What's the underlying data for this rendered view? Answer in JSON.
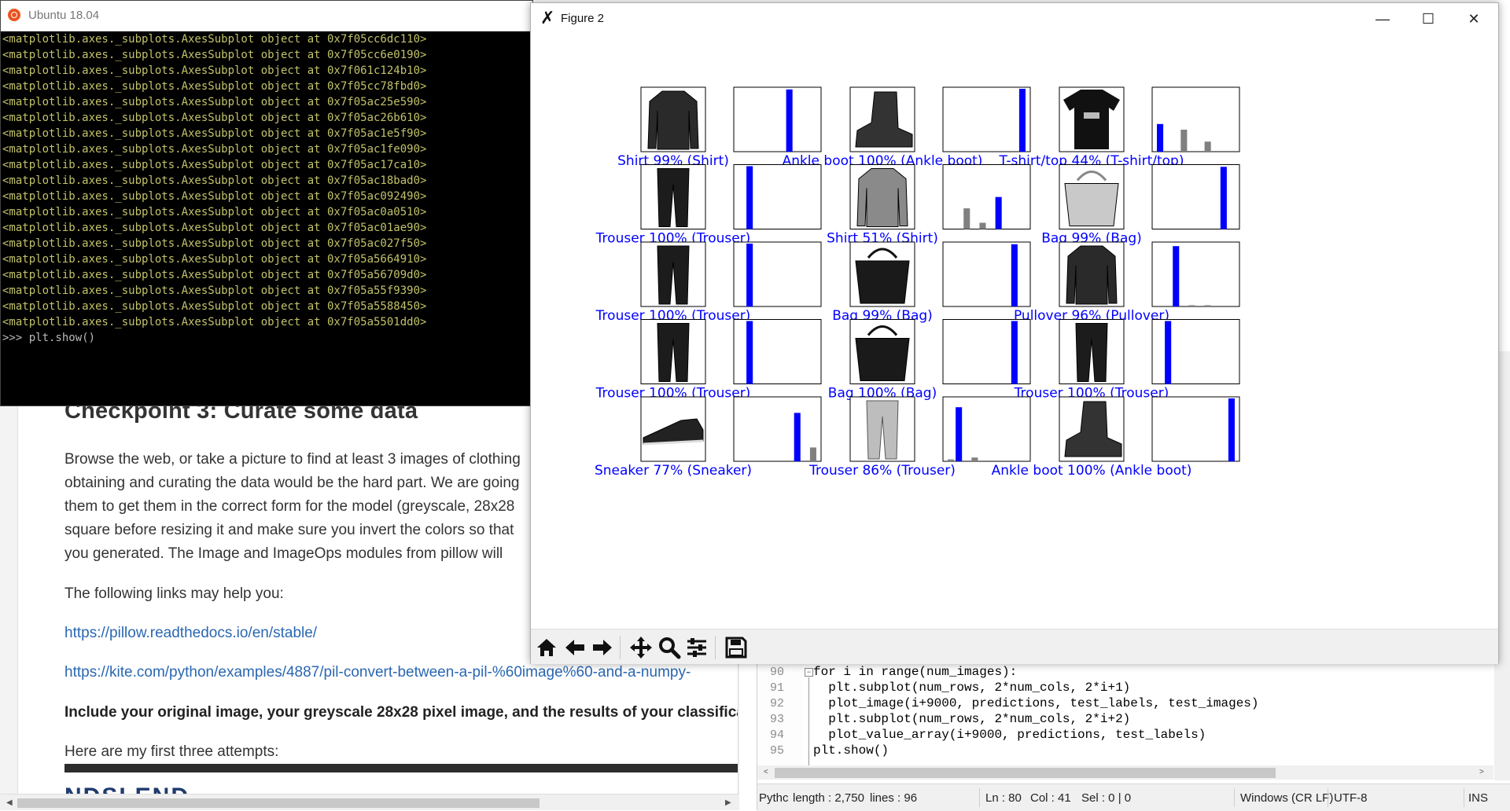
{
  "terminal": {
    "title": "Ubuntu 18.04",
    "lines": [
      "<matplotlib.axes._subplots.AxesSubplot object at 0x7f05cc6dc110>",
      "<matplotlib.axes._subplots.AxesSubplot object at 0x7f05cc6e0190>",
      "<matplotlib.axes._subplots.AxesSubplot object at 0x7f061c124b10>",
      "<matplotlib.axes._subplots.AxesSubplot object at 0x7f05cc78fbd0>",
      "<matplotlib.axes._subplots.AxesSubplot object at 0x7f05ac25e590>",
      "<matplotlib.axes._subplots.AxesSubplot object at 0x7f05ac26b610>",
      "<matplotlib.axes._subplots.AxesSubplot object at 0x7f05ac1e5f90>",
      "<matplotlib.axes._subplots.AxesSubplot object at 0x7f05ac1fe090>",
      "<matplotlib.axes._subplots.AxesSubplot object at 0x7f05ac17ca10>",
      "<matplotlib.axes._subplots.AxesSubplot object at 0x7f05ac18bad0>",
      "<matplotlib.axes._subplots.AxesSubplot object at 0x7f05ac092490>",
      "<matplotlib.axes._subplots.AxesSubplot object at 0x7f05ac0a0510>",
      "<matplotlib.axes._subplots.AxesSubplot object at 0x7f05ac01ae90>",
      "<matplotlib.axes._subplots.AxesSubplot object at 0x7f05ac027f50>",
      "<matplotlib.axes._subplots.AxesSubplot object at 0x7f05a5664910>",
      "<matplotlib.axes._subplots.AxesSubplot object at 0x7f05a56709d0>",
      "<matplotlib.axes._subplots.AxesSubplot object at 0x7f05a55f9390>",
      "<matplotlib.axes._subplots.AxesSubplot object at 0x7f05a5588450>",
      "<matplotlib.axes._subplots.AxesSubplot object at 0x7f05a5501dd0>"
    ],
    "prompt": ">>> plt.show()"
  },
  "figure": {
    "title": "Figure 2",
    "label_color": "#0000ff",
    "bar_color": "#0000ff",
    "other_bar_color": "#808080",
    "toolbar_icons": [
      "home-icon",
      "back-arrow-icon",
      "forward-arrow-icon",
      "pan-icon",
      "zoom-icon",
      "configure-subplots-icon",
      "save-icon"
    ]
  },
  "chart_data": {
    "type": "bar",
    "rows": 5,
    "cols": 3,
    "num_classes": 10,
    "ylim": [
      0,
      1
    ],
    "panels": [
      {
        "label": "Shirt 99% (Shirt)",
        "image": "shirt",
        "values": [
          0,
          0,
          0,
          0,
          0,
          0,
          0.99,
          0,
          0,
          0
        ]
      },
      {
        "label": "Ankle boot 100% (Ankle boot)",
        "image": "ankle boot",
        "values": [
          0,
          0,
          0,
          0,
          0,
          0,
          0,
          0,
          0,
          1.0
        ]
      },
      {
        "label": "T-shirt/top 44% (T-shirt/top)",
        "image": "t-shirt",
        "values": [
          0.44,
          0,
          0,
          0.35,
          0,
          0,
          0.16,
          0,
          0,
          0
        ]
      },
      {
        "label": "Trouser 100% (Trouser)",
        "image": "trouser",
        "values": [
          0,
          1.0,
          0,
          0,
          0,
          0,
          0,
          0,
          0,
          0
        ]
      },
      {
        "label": "Shirt 51% (Shirt)",
        "image": "shirt",
        "values": [
          0,
          0,
          0.33,
          0,
          0.1,
          0,
          0.51,
          0,
          0,
          0
        ]
      },
      {
        "label": "Bag 99% (Bag)",
        "image": "bag",
        "values": [
          0,
          0,
          0,
          0,
          0,
          0,
          0,
          0,
          0.99,
          0
        ]
      },
      {
        "label": "Trouser 100% (Trouser)",
        "image": "trouser",
        "values": [
          0,
          1.0,
          0,
          0,
          0,
          0,
          0,
          0,
          0,
          0
        ]
      },
      {
        "label": "Bag 99% (Bag)",
        "image": "bag",
        "values": [
          0,
          0,
          0,
          0,
          0,
          0,
          0,
          0,
          0.99,
          0
        ]
      },
      {
        "label": "Pullover 96% (Pullover)",
        "image": "pullover",
        "values": [
          0,
          0,
          0.96,
          0,
          0.02,
          0,
          0.02,
          0,
          0,
          0
        ]
      },
      {
        "label": "Trouser 100% (Trouser)",
        "image": "trouser",
        "values": [
          0,
          1.0,
          0,
          0,
          0,
          0,
          0,
          0,
          0,
          0
        ]
      },
      {
        "label": "Bag 100% (Bag)",
        "image": "bag",
        "values": [
          0,
          0,
          0,
          0,
          0,
          0,
          0,
          0,
          1.0,
          0
        ]
      },
      {
        "label": "Trouser 100% (Trouser)",
        "image": "trouser",
        "values": [
          0,
          1.0,
          0,
          0,
          0,
          0,
          0,
          0,
          0,
          0
        ]
      },
      {
        "label": "Sneaker 77% (Sneaker)",
        "image": "sneaker",
        "values": [
          0,
          0,
          0,
          0,
          0,
          0,
          0,
          0.77,
          0,
          0.22
        ]
      },
      {
        "label": "Trouser 86% (Trouser)",
        "image": "trouser",
        "values": [
          0.03,
          0.86,
          0,
          0.06,
          0,
          0,
          0,
          0,
          0,
          0
        ]
      },
      {
        "label": "Ankle boot 100% (Ankle boot)",
        "image": "ankle boot",
        "values": [
          0,
          0,
          0,
          0,
          0,
          0,
          0,
          0,
          0,
          1.0
        ]
      }
    ]
  },
  "webpage": {
    "heading": "Checkpoint 3: Curate some data",
    "paragraph_lines": [
      "Browse the web, or take a picture to find at least 3 images of clothing",
      "obtaining and curating the data would be the hard part. We are going",
      "them to get them in the correct form for the model (greyscale, 28x28",
      "square before resizing it and make sure you invert the colors so that",
      "you generated. The Image and ImageOps modules from pillow will"
    ],
    "links_intro": "The following links may help you:",
    "link1": "https://pillow.readthedocs.io/en/stable/",
    "link2": "https://kite.com/python/examples/4887/pil-convert-between-a-pil-%60image%60-and-a-numpy-",
    "bold_line": "Include your original image, your greyscale 28x28 pixel image, and the results of your classifica",
    "attempts_line": "Here are my first three attempts:",
    "banner_text": "NDSLEND"
  },
  "editor": {
    "lines": [
      {
        "num": "90",
        "text": "for i in range(num_images):"
      },
      {
        "num": "91",
        "text": "  plt.subplot(num_rows, 2*num_cols, 2*i+1)"
      },
      {
        "num": "92",
        "text": "  plot_image(i+9000, predictions, test_labels, test_images)"
      },
      {
        "num": "93",
        "text": "  plt.subplot(num_rows, 2*num_cols, 2*i+2)"
      },
      {
        "num": "94",
        "text": "  plot_value_array(i+9000, predictions, test_labels)"
      },
      {
        "num": "95",
        "text": "plt.show()"
      }
    ],
    "status": {
      "lang": "Pythc",
      "length": "length : 2,750",
      "lines": "lines : 96",
      "ln": "Ln : 80",
      "col": "Col : 41",
      "sel": "Sel : 0 | 0",
      "eol": "Windows (CR LF)",
      "encoding": "UTF-8",
      "mode": "INS"
    }
  }
}
